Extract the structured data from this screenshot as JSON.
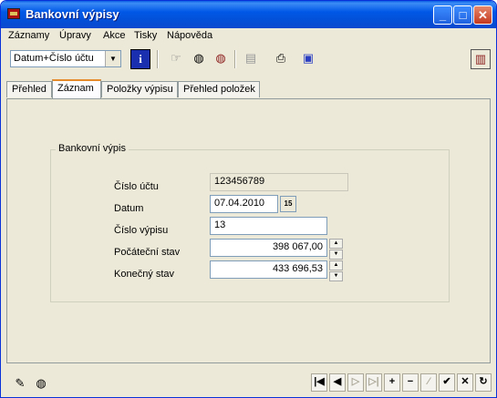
{
  "window": {
    "title": "Bankovní výpisy"
  },
  "title_buttons": {
    "minimize": "_",
    "maximize": "□",
    "close": "✕"
  },
  "menu": [
    "Záznamy",
    "Úpravy",
    "Akce",
    "Tisky",
    "Nápověda"
  ],
  "toolbar": {
    "sort_combo_value": "Datum+Číslo účtu"
  },
  "tabs": [
    "Přehled",
    "Záznam",
    "Položky výpisu",
    "Přehled položek"
  ],
  "active_tab": "Záznam",
  "form": {
    "group_title": "Bankovní výpis",
    "account_label": "Číslo účtu",
    "account_value": "123456789",
    "date_label": "Datum",
    "date_value": "07.04.2010",
    "statement_no_label": "Číslo výpisu",
    "statement_no_value": "13",
    "opening_balance_label": "Počáteční stav",
    "opening_balance_value": "398 067,00",
    "closing_balance_label": "Konečný stav",
    "closing_balance_value": "433 696,53"
  },
  "icons": {
    "calendar": "15",
    "nav_first": "|◀",
    "nav_prev": "◀",
    "nav_next": "▷",
    "nav_last": "▷|",
    "add": "+",
    "remove": "−",
    "edit": "⁄",
    "confirm": "✔",
    "cancel": "✕",
    "refresh": "↻"
  }
}
